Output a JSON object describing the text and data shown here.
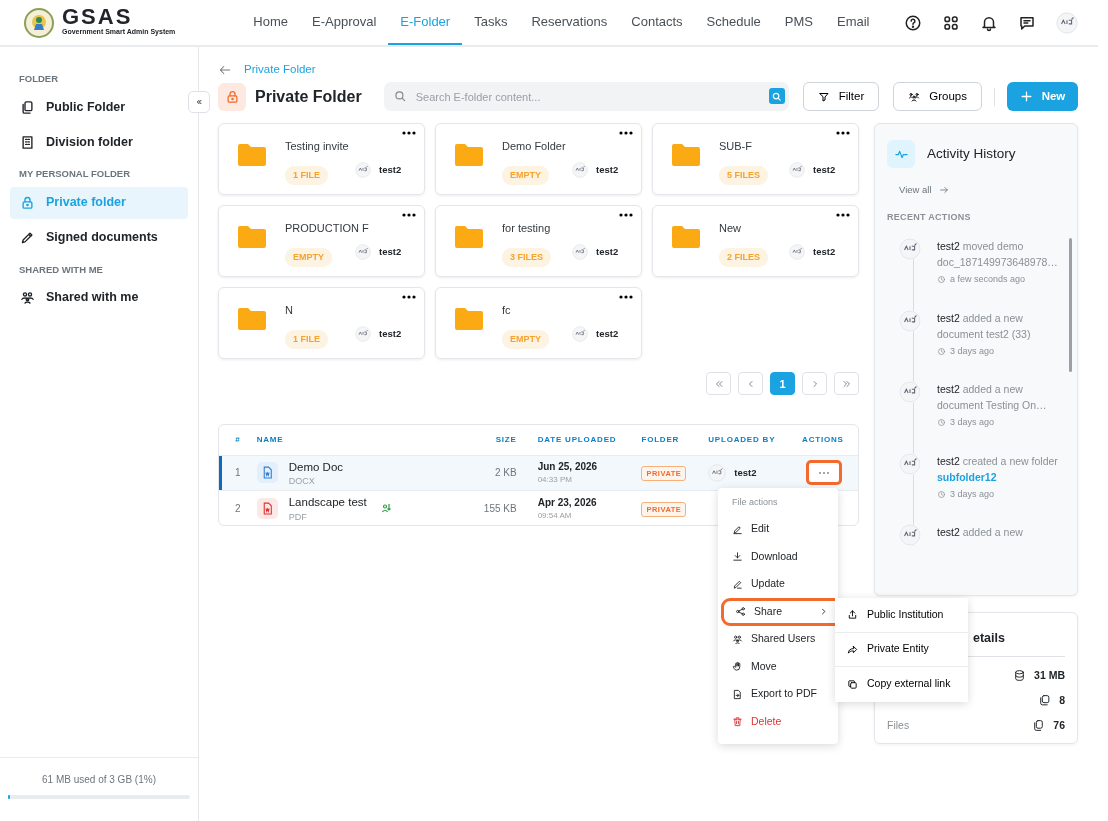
{
  "brand": {
    "name": "GSAS",
    "tagline": "Government Smart Admin System"
  },
  "nav": [
    {
      "label": "Home",
      "selected": false
    },
    {
      "label": "E-Approval",
      "selected": false
    },
    {
      "label": "E-Folder",
      "selected": true
    },
    {
      "label": "Tasks",
      "selected": false
    },
    {
      "label": "Reservations",
      "selected": false
    },
    {
      "label": "Contacts",
      "selected": false
    },
    {
      "label": "Schedule",
      "selected": false
    },
    {
      "label": "PMS",
      "selected": false
    },
    {
      "label": "Email",
      "selected": false
    }
  ],
  "sidebar": {
    "sections": [
      {
        "heading": "FOLDER",
        "items": [
          {
            "label": "Public Folder",
            "kind": "pages",
            "selected": false
          },
          {
            "label": "Division folder",
            "kind": "building",
            "selected": false
          }
        ]
      },
      {
        "heading": "MY PERSONAL FOLDER",
        "items": [
          {
            "label": "Private folder",
            "kind": "lock",
            "selected": true
          },
          {
            "label": "Signed documents",
            "kind": "pen",
            "selected": false
          }
        ]
      },
      {
        "heading": "SHARED WITH ME",
        "items": [
          {
            "label": "Shared with me",
            "kind": "users",
            "selected": false
          }
        ]
      }
    ],
    "storage": {
      "text": "61 MB used of 3 GB (1%)",
      "level": 0.01
    }
  },
  "breadcrumb": "Private Folder",
  "title": "Private Folder",
  "search": {
    "placeholder": "Search E-folder content..."
  },
  "buttons": [
    {
      "label": "Filter",
      "kind": "filter"
    },
    {
      "label": "Groups",
      "kind": "groups"
    },
    {
      "label": "New",
      "kind": "new"
    }
  ],
  "folders": [
    {
      "name": "Testing invite",
      "count": "1 FILE",
      "owner": "test2"
    },
    {
      "name": "Demo Folder",
      "count": "EMPTY",
      "owner": "test2"
    },
    {
      "name": "SUB-F",
      "count": "5 FILES",
      "owner": "test2"
    },
    {
      "name": "PRODUCTION F",
      "count": "EMPTY",
      "owner": "test2"
    },
    {
      "name": "for testing",
      "count": "3 FILES",
      "owner": "test2"
    },
    {
      "name": "New",
      "count": "2 FILES",
      "owner": "test2"
    },
    {
      "name": "N",
      "count": "1 FILE",
      "owner": "test2"
    },
    {
      "name": "fc",
      "count": "EMPTY",
      "owner": "test2"
    }
  ],
  "pagination": {
    "pages": [
      {
        "label": "1",
        "selected": true
      }
    ]
  },
  "table": {
    "columns": [
      "#",
      "NAME",
      "SIZE",
      "DATE UPLOADED",
      "FOLDER",
      "UPLOADED BY",
      "ACTIONS"
    ],
    "rows": [
      {
        "index": "1",
        "name": "Demo Doc",
        "type": "DOCX",
        "kind": "docx",
        "shared": false,
        "size": "2 KB",
        "date": "Jun 25, 2026",
        "time": "04:33 PM",
        "folder": "PRIVATE",
        "uploaded_by": "test2",
        "selected": true
      },
      {
        "index": "2",
        "name": "Landscape test",
        "type": "PDF",
        "kind": "pdf",
        "shared": true,
        "size": "155 KB",
        "date": "Apr 23, 2026",
        "time": "09:54 AM",
        "folder": "PRIVATE",
        "selected": false
      }
    ]
  },
  "menu": {
    "heading": "File actions",
    "items": [
      {
        "label": "Edit",
        "kind": "edit",
        "selected": false
      },
      {
        "label": "Download",
        "kind": "download",
        "selected": false
      },
      {
        "label": "Update",
        "kind": "update",
        "selected": false
      },
      {
        "label": "Share",
        "kind": "share",
        "selected": true,
        "submenu": true
      },
      {
        "label": "Shared Users",
        "kind": "users",
        "selected": false
      },
      {
        "label": "Move",
        "kind": "move",
        "selected": false
      },
      {
        "label": "Export to PDF",
        "kind": "export",
        "selected": false
      },
      {
        "label": "Delete",
        "kind": "delete",
        "selected": false
      }
    ],
    "submenu": [
      {
        "label": "Public Institution",
        "kind": "upload"
      },
      {
        "label": "Private Entity",
        "kind": "forward"
      },
      {
        "label": "Copy external link",
        "kind": "copy"
      }
    ]
  },
  "activity": {
    "title": "Activity History",
    "view_all": "View all",
    "heading": "RECENT ACTIONS",
    "items": [
      {
        "user": "test2",
        "text": "moved demo doc_187149973648978…",
        "time": "a few seconds ago"
      },
      {
        "user": "test2",
        "text": "added a new document  test2 (33)",
        "time": "3 days ago"
      },
      {
        "user": "test2",
        "text": "added a new document  Testing On…",
        "time": "3 days ago"
      },
      {
        "user": "test2",
        "text": "created a new folder",
        "link": "subfolder12",
        "time": "3 days ago"
      },
      {
        "user": "test2",
        "text": "added a new"
      }
    ]
  },
  "details": {
    "title": "etails",
    "rows": [
      {
        "value": "31 MB",
        "kind": "database"
      },
      {
        "value": "8",
        "kind": "folders"
      },
      {
        "label": "Files",
        "value": "76",
        "kind": "files"
      }
    ]
  }
}
